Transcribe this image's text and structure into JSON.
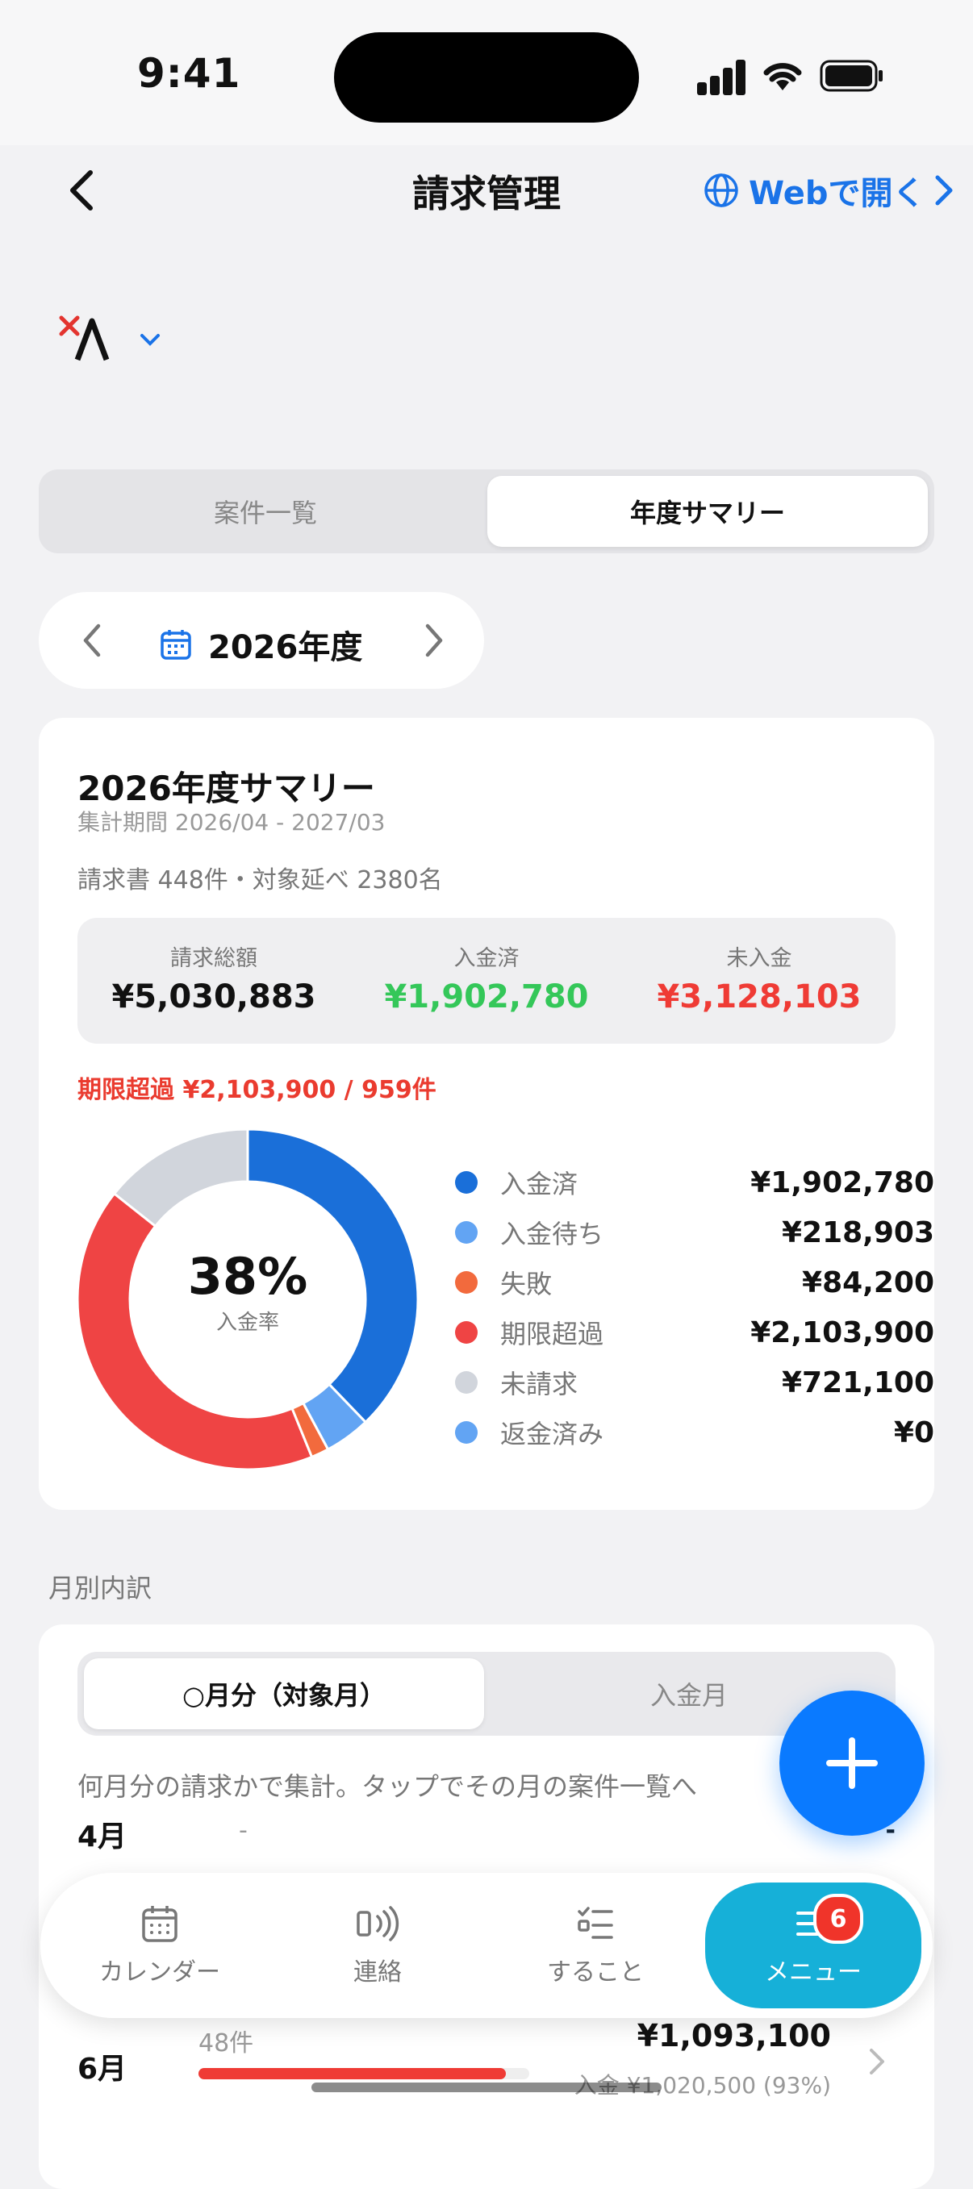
{
  "status": {
    "time": "9:41"
  },
  "header": {
    "title": "請求管理",
    "web_label": "Webで開く"
  },
  "tabs": {
    "list": "案件一覧",
    "summary": "年度サマリー"
  },
  "year": {
    "label": "2026年度"
  },
  "summary": {
    "title": "2026年度サマリー",
    "period": "集計期間 2026/04 - 2027/03",
    "count": "請求書 448件・対象延べ 2380名",
    "stats": [
      {
        "label": "請求総額",
        "value": "¥5,030,883"
      },
      {
        "label": "入金済",
        "value": "¥1,902,780"
      },
      {
        "label": "未入金",
        "value": "¥3,128,103"
      }
    ],
    "overdue": "期限超過 ¥2,103,900 / 959件",
    "rate": "38%",
    "rate_label": "入金率"
  },
  "colors": {
    "paid": "#1a6fd9",
    "waiting": "#62a4f3",
    "failed": "#f26a3d",
    "overdue": "#ef4444",
    "unbilled": "#d1d5dc",
    "refunded": "#62a4f3",
    "green": "#34c759",
    "red": "#ef3b35",
    "fab": "#0a7aff",
    "menu": "#16b0d8"
  },
  "chart_data": {
    "type": "pie",
    "categories": [
      "入金済",
      "入金待ち",
      "失敗",
      "期限超過",
      "未請求",
      "返金済み"
    ],
    "values": [
      1902780,
      218903,
      84200,
      2103900,
      721100,
      0
    ]
  },
  "legend": [
    {
      "name": "入金済",
      "value": "¥1,902,780"
    },
    {
      "name": "入金待ち",
      "value": "¥218,903"
    },
    {
      "name": "失敗",
      "value": "¥84,200"
    },
    {
      "name": "期限超過",
      "value": "¥2,103,900"
    },
    {
      "name": "未請求",
      "value": "¥721,100"
    },
    {
      "name": "返金済み",
      "value": "¥0"
    }
  ],
  "monthly": {
    "section": "月別内訳",
    "tab_target": "○月分（対象月）",
    "tab_payment": "入金月",
    "hint": "何月分の請求かで集計。タップでその月の案件一覧へ",
    "rows": [
      {
        "month": "4月",
        "count": "-",
        "amount": "-"
      },
      {
        "month": "6月",
        "count": "48件",
        "amount": "¥1,093,100",
        "paid": "入金 ¥1,020,500 (93%)",
        "ratio": 0.93
      }
    ]
  },
  "tabbar": {
    "calendar": "カレンダー",
    "contact": "連絡",
    "todo": "すること",
    "menu": "メニュー",
    "badge": "6"
  }
}
